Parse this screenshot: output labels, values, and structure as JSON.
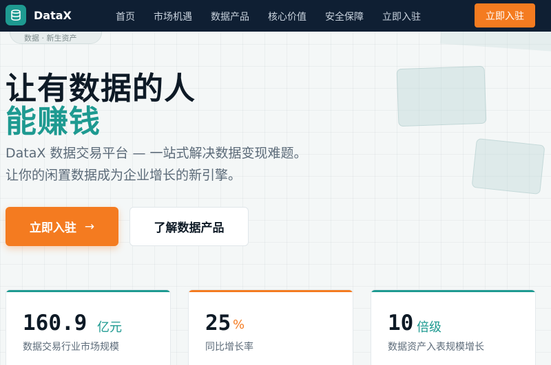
{
  "nav": {
    "brand": "DataX",
    "links": [
      "首页",
      "市场机遇",
      "数据产品",
      "核心价值",
      "安全保障",
      "立即入驻"
    ],
    "cta": "立即入驻"
  },
  "badge": {
    "text": "数据 · 新生资产"
  },
  "hero": {
    "title_line1": "让有数据的人",
    "title_line2": "能赚钱",
    "subtitle_line1": "DataX 数据交易平台 — 一站式解决数据变现难题。",
    "subtitle_line2": "让你的闲置数据成为企业增长的新引擎。",
    "primary_button": "立即入驻",
    "primary_arrow": "→",
    "secondary_button": "了解数据产品"
  },
  "stats": [
    {
      "value": "160.9",
      "unit": "亿元",
      "label": "数据交易行业市场规模",
      "accent": "#1e9a91",
      "unit_color": "#1e9a91"
    },
    {
      "value": "25",
      "unit": "%",
      "label": "同比增长率",
      "accent": "#f47b20",
      "unit_color": "#f47b20"
    },
    {
      "value": "10",
      "unit": "倍级",
      "label": "数据资产入表规模增长",
      "accent": "#1e9a91",
      "unit_color": "#1e9a91"
    }
  ],
  "colors": {
    "nav_bg": "#0f1f33",
    "accent_teal": "#1e9a91",
    "accent_orange": "#f47b20"
  },
  "icons": {
    "logo": "database-icon"
  }
}
